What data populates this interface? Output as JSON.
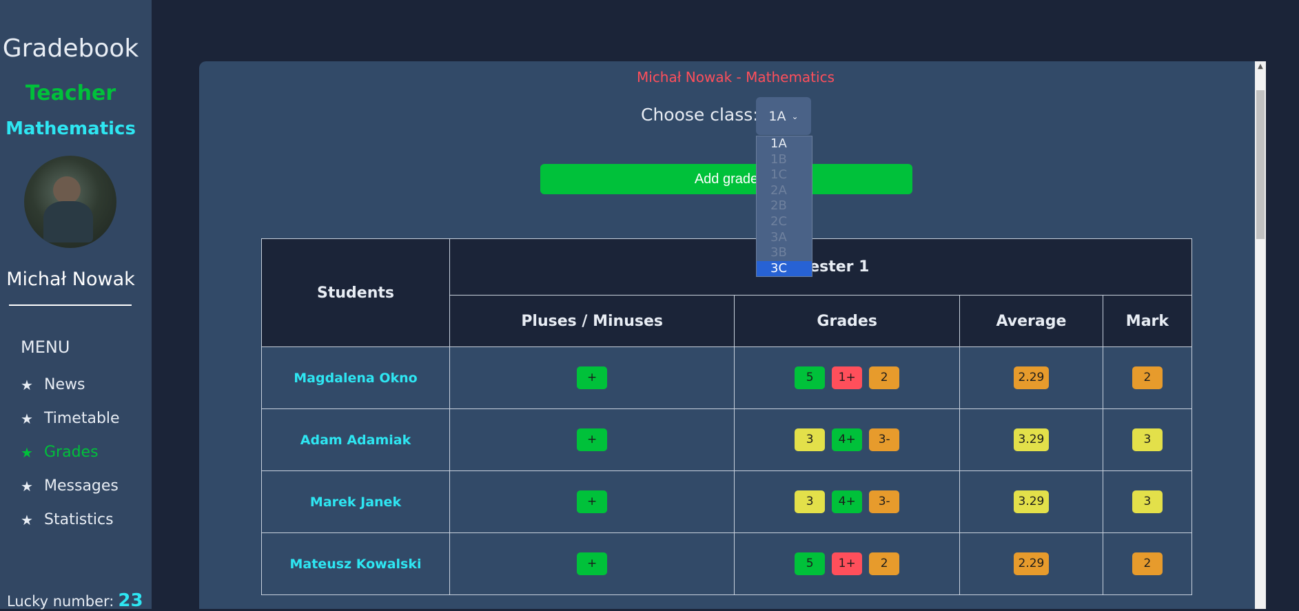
{
  "sidebar": {
    "app_title": "Gradebook",
    "role": "Teacher",
    "subject": "Mathematics",
    "user_name": "Michał Nowak",
    "menu_title": "MENU",
    "menu": [
      {
        "label": "News",
        "icon": "star-icon",
        "active": false
      },
      {
        "label": "Timetable",
        "icon": "star-icon",
        "active": false
      },
      {
        "label": "Grades",
        "icon": "star-icon",
        "active": true
      },
      {
        "label": "Messages",
        "icon": "star-icon",
        "active": false
      },
      {
        "label": "Statistics",
        "icon": "star-icon",
        "active": false
      }
    ],
    "lucky_label": "Lucky number:",
    "lucky_number": "23"
  },
  "main": {
    "header": "Michał Nowak - Mathematics",
    "choose_class_label": "Choose class:",
    "selected_class": "1A",
    "class_options": [
      "1A",
      "1B",
      "1C",
      "2A",
      "2B",
      "2C",
      "3A",
      "3B",
      "3C"
    ],
    "highlighted_option": "3C",
    "add_grade_label": "Add grade",
    "table": {
      "students_header": "Students",
      "semester_header": "Semester 1",
      "columns": [
        "Pluses / Minuses",
        "Grades",
        "Average",
        "Mark"
      ],
      "rows": [
        {
          "name": "Magdalena Okno",
          "pm": [
            "+"
          ],
          "grades": [
            {
              "v": "5",
              "c": "green"
            },
            {
              "v": "1+",
              "c": "red"
            },
            {
              "v": "2",
              "c": "orange"
            }
          ],
          "average": {
            "v": "2.29",
            "c": "orange"
          },
          "mark": {
            "v": "2",
            "c": "orange"
          }
        },
        {
          "name": "Adam Adamiak",
          "pm": [
            "+"
          ],
          "grades": [
            {
              "v": "3",
              "c": "yellow"
            },
            {
              "v": "4+",
              "c": "green"
            },
            {
              "v": "3-",
              "c": "orange"
            }
          ],
          "average": {
            "v": "3.29",
            "c": "yellow"
          },
          "mark": {
            "v": "3",
            "c": "yellow"
          }
        },
        {
          "name": "Marek Janek",
          "pm": [
            "+"
          ],
          "grades": [
            {
              "v": "3",
              "c": "yellow"
            },
            {
              "v": "4+",
              "c": "green"
            },
            {
              "v": "3-",
              "c": "orange"
            }
          ],
          "average": {
            "v": "3.29",
            "c": "yellow"
          },
          "mark": {
            "v": "3",
            "c": "yellow"
          }
        },
        {
          "name": "Mateusz Kowalski",
          "pm": [
            "+"
          ],
          "grades": [
            {
              "v": "5",
              "c": "green"
            },
            {
              "v": "1+",
              "c": "red"
            },
            {
              "v": "2",
              "c": "orange"
            }
          ],
          "average": {
            "v": "2.29",
            "c": "orange"
          },
          "mark": {
            "v": "2",
            "c": "orange"
          }
        }
      ]
    }
  },
  "colors": {
    "accent_green": "#00c13a",
    "accent_cyan": "#2ee6f2",
    "accent_red": "#ff4f5b",
    "grade_orange": "#e79b2c",
    "grade_yellow": "#e3e04a"
  }
}
